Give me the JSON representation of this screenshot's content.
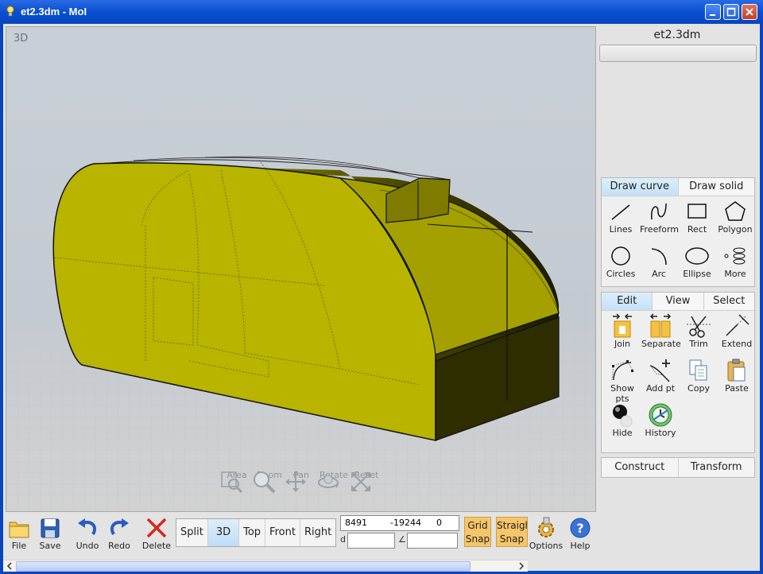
{
  "window": {
    "title": "et2.3dm - MoI"
  },
  "viewport": {
    "label": "3D",
    "nav_tools": [
      {
        "label": "Area",
        "icon": "area-zoom-icon"
      },
      {
        "label": "Zoom",
        "icon": "magnifier-icon"
      },
      {
        "label": "Pan",
        "icon": "pan-arrows-icon"
      },
      {
        "label": "Rotate",
        "icon": "rotate-icon"
      },
      {
        "label": "Reset",
        "icon": "reset-icon"
      }
    ]
  },
  "panel": {
    "filename": "et2.3dm",
    "name_field_value": "",
    "draw_tabs": [
      "Draw curve",
      "Draw solid"
    ],
    "draw_tools": [
      {
        "label": "Lines",
        "icon": "line-icon"
      },
      {
        "label": "Freeform",
        "icon": "freeform-icon"
      },
      {
        "label": "Rect",
        "icon": "rectangle-icon"
      },
      {
        "label": "Polygon",
        "icon": "polygon-icon"
      },
      {
        "label": "Circles",
        "icon": "circle-icon"
      },
      {
        "label": "Arc",
        "icon": "arc-icon"
      },
      {
        "label": "Ellipse",
        "icon": "ellipse-icon"
      },
      {
        "label": "More",
        "icon": "helix-icon"
      }
    ],
    "edit_tabs": [
      "Edit",
      "View",
      "Select"
    ],
    "edit_tools": [
      {
        "label": "Join",
        "icon": "join-icon"
      },
      {
        "label": "Separate",
        "icon": "separate-icon"
      },
      {
        "label": "Trim",
        "icon": "scissors-icon"
      },
      {
        "label": "Extend",
        "icon": "extend-icon"
      },
      {
        "label": "Show pts",
        "icon": "show-points-icon"
      },
      {
        "label": "Add pt",
        "icon": "add-point-icon"
      },
      {
        "label": "Copy",
        "icon": "copy-icon"
      },
      {
        "label": "Paste",
        "icon": "paste-icon"
      },
      {
        "label": "Hide",
        "icon": "hide-icon"
      },
      {
        "label": "History",
        "icon": "history-icon"
      }
    ],
    "bottom_tabs": [
      "Construct",
      "Transform"
    ]
  },
  "toolbar": {
    "file": "File",
    "save": "Save",
    "undo": "Undo",
    "redo": "Redo",
    "delete": "Delete",
    "views": [
      "Split",
      "3D",
      "Top",
      "Front",
      "Right"
    ],
    "active_view": "3D",
    "coords": {
      "x": "8491",
      "y": "-19244",
      "z": "0"
    },
    "distance_label": "d",
    "angle_label": "∠",
    "grid_snap": [
      "Grid",
      "Snap"
    ],
    "straight_snap": [
      "Straight",
      "Snap"
    ],
    "options": "Options",
    "help": "Help"
  },
  "colors": {
    "title_bar": "#0A4FD0",
    "model_yellow": "#B8B400",
    "active_tab": "#C4E1F8",
    "snap_button": "#F7C56A"
  }
}
